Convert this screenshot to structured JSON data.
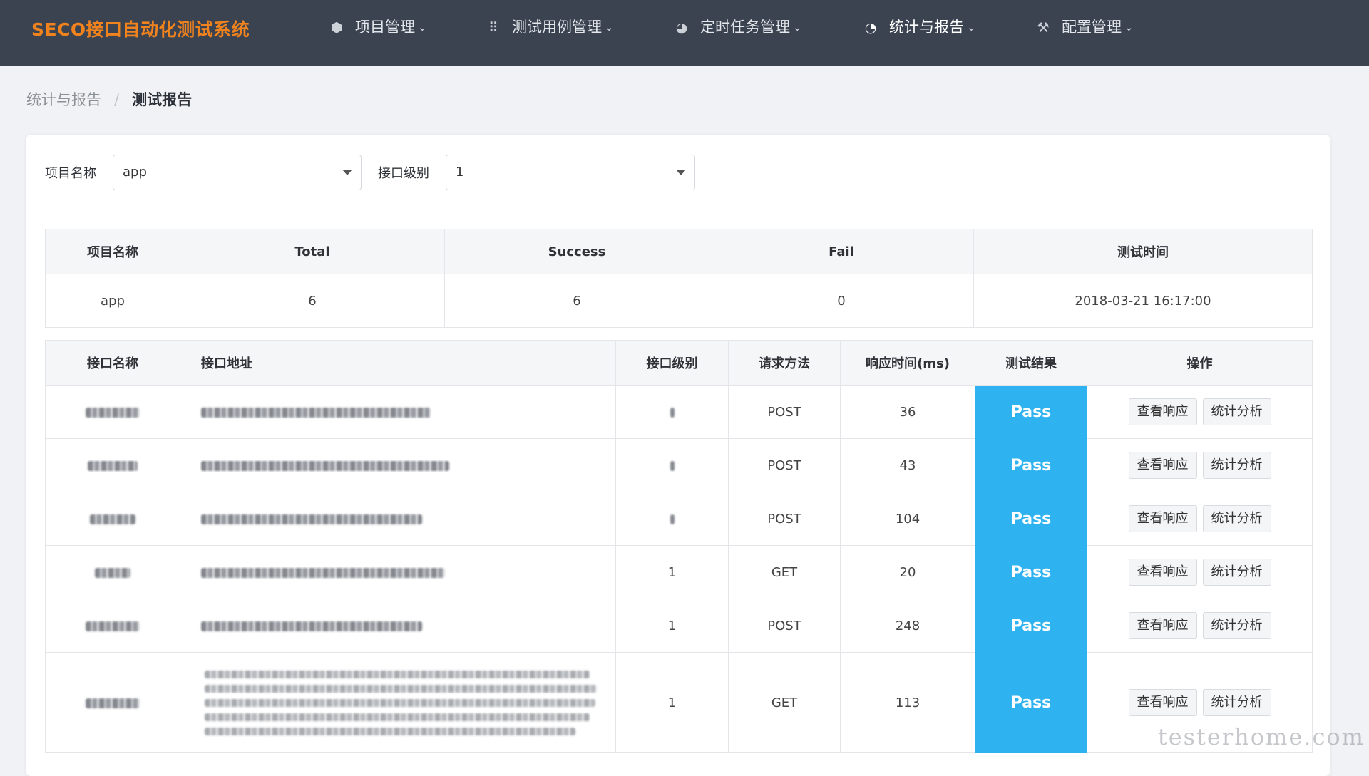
{
  "brand": "SECO接口自动化测试系统",
  "nav": [
    {
      "icon": "cube-icon",
      "glyph": "⬢",
      "label": "项目管理",
      "active": false
    },
    {
      "icon": "grid-icon",
      "glyph": "⠿",
      "label": "测试用例管理",
      "active": false
    },
    {
      "icon": "clock-icon",
      "glyph": "◕",
      "label": "定时任务管理",
      "active": false
    },
    {
      "icon": "pie-chart-icon",
      "glyph": "◔",
      "label": "统计与报告",
      "active": true
    },
    {
      "icon": "tools-icon",
      "glyph": "⚒",
      "label": "配置管理",
      "active": false
    }
  ],
  "breadcrumb": {
    "parent": "统计与报告",
    "separator": "/",
    "current": "测试报告"
  },
  "filters": {
    "project_label": "项目名称",
    "project_value": "app",
    "level_label": "接口级别",
    "level_value": "1"
  },
  "summary": {
    "headers": [
      "项目名称",
      "Total",
      "Success",
      "Fail",
      "测试时间"
    ],
    "row": [
      "app",
      "6",
      "6",
      "0",
      "2018-03-21 16:17:00"
    ]
  },
  "detail": {
    "headers": [
      "接口名称",
      "接口地址",
      "接口级别",
      "请求方法",
      "响应时间(ms)",
      "测试结果",
      "操作"
    ],
    "rows": [
      {
        "name": "",
        "url": "",
        "level": "",
        "method": "POST",
        "time": "36",
        "result": "Pass"
      },
      {
        "name": "",
        "url": "",
        "level": "",
        "method": "POST",
        "time": "43",
        "result": "Pass"
      },
      {
        "name": "",
        "url": "",
        "level": "",
        "method": "POST",
        "time": "104",
        "result": "Pass"
      },
      {
        "name": "",
        "url": "",
        "level": "1",
        "method": "GET",
        "time": "20",
        "result": "Pass"
      },
      {
        "name": "",
        "url": "",
        "level": "1",
        "method": "POST",
        "time": "248",
        "result": "Pass"
      },
      {
        "name": "",
        "url": "",
        "level": "1",
        "method": "GET",
        "time": "113",
        "result": "Pass"
      }
    ],
    "action_view": "查看响应",
    "action_stats": "统计分析"
  },
  "watermark": "testerhome.com",
  "colors": {
    "topbar": "#3b4351",
    "brand": "#f0831e",
    "pass": "#2fb2f0"
  }
}
